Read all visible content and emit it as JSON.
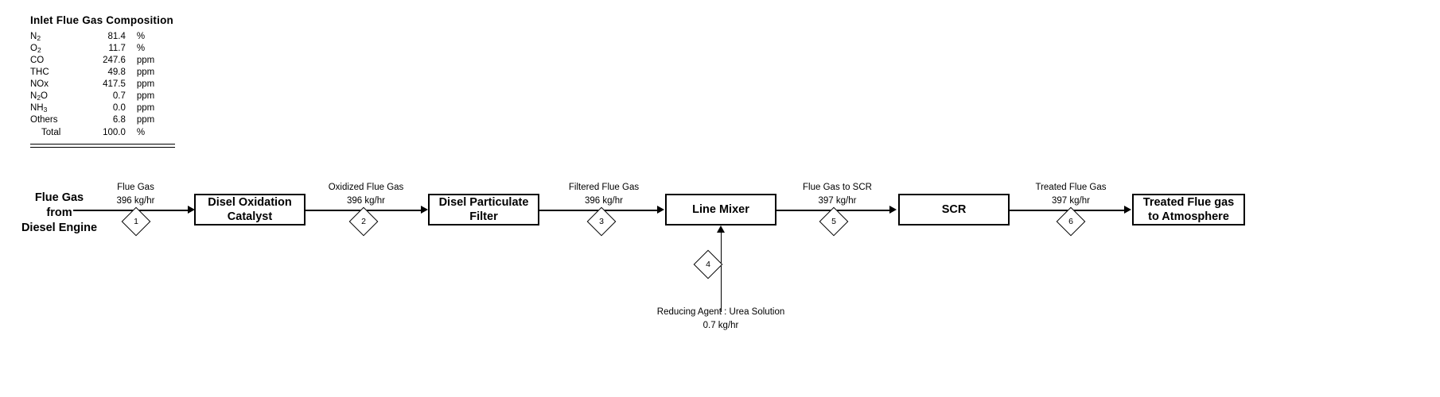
{
  "composition": {
    "title": "Inlet Flue Gas Composition",
    "rows": [
      {
        "name": "N2",
        "name_base": "N",
        "name_sub": "2",
        "value": "81.4",
        "unit": "%"
      },
      {
        "name": "O2",
        "name_base": "O",
        "name_sub": "2",
        "value": "11.7",
        "unit": "%"
      },
      {
        "name": "CO",
        "name_base": "CO",
        "name_sub": "",
        "value": "247.6",
        "unit": "ppm"
      },
      {
        "name": "THC",
        "name_base": "THC",
        "name_sub": "",
        "value": "49.8",
        "unit": "ppm"
      },
      {
        "name": "NOx",
        "name_base": "NOx",
        "name_sub": "",
        "value": "417.5",
        "unit": "ppm"
      },
      {
        "name": "N2O",
        "name_base": "N",
        "name_sub": "2",
        "name_tail": "O",
        "value": "0.7",
        "unit": "ppm"
      },
      {
        "name": "NH3",
        "name_base": "NH",
        "name_sub": "3",
        "value": "0.0",
        "unit": "ppm"
      },
      {
        "name": "Others",
        "name_base": "Others",
        "name_sub": "",
        "value": "6.8",
        "unit": "ppm"
      }
    ],
    "total": {
      "name": "Total",
      "value": "100.0",
      "unit": "%"
    }
  },
  "feed": {
    "label_line1": "Flue Gas",
    "label_line2": "from",
    "label_line3": "Diesel Engine"
  },
  "equipment": [
    {
      "id": "doc",
      "name_line1": "Disel Oxidation",
      "name_line2": "Catalyst"
    },
    {
      "id": "dpf",
      "name_line1": "Disel Particulate",
      "name_line2": "Filter"
    },
    {
      "id": "line-mixer",
      "name_line1": "Line Mixer",
      "name_line2": ""
    },
    {
      "id": "scr",
      "name_line1": "SCR",
      "name_line2": ""
    }
  ],
  "product": {
    "label_line1": "Treated Flue gas",
    "label_line2": "to Atmosphere"
  },
  "streams": [
    {
      "number": "1",
      "name": "Flue Gas",
      "flow": "396  kg/hr"
    },
    {
      "number": "2",
      "name": "Oxidized Flue Gas",
      "flow": "396  kg/hr"
    },
    {
      "number": "3",
      "name": "Filtered Flue Gas",
      "flow": "396  kg/hr"
    },
    {
      "number": "5",
      "name": "Flue Gas  to SCR",
      "flow": "397  kg/hr"
    },
    {
      "number": "6",
      "name": "Treated Flue Gas",
      "flow": "397  kg/hr"
    }
  ],
  "reducing_agent": {
    "number": "4",
    "name": "Reducing Agent : Urea Solution",
    "flow": "0.7 kg/hr"
  }
}
